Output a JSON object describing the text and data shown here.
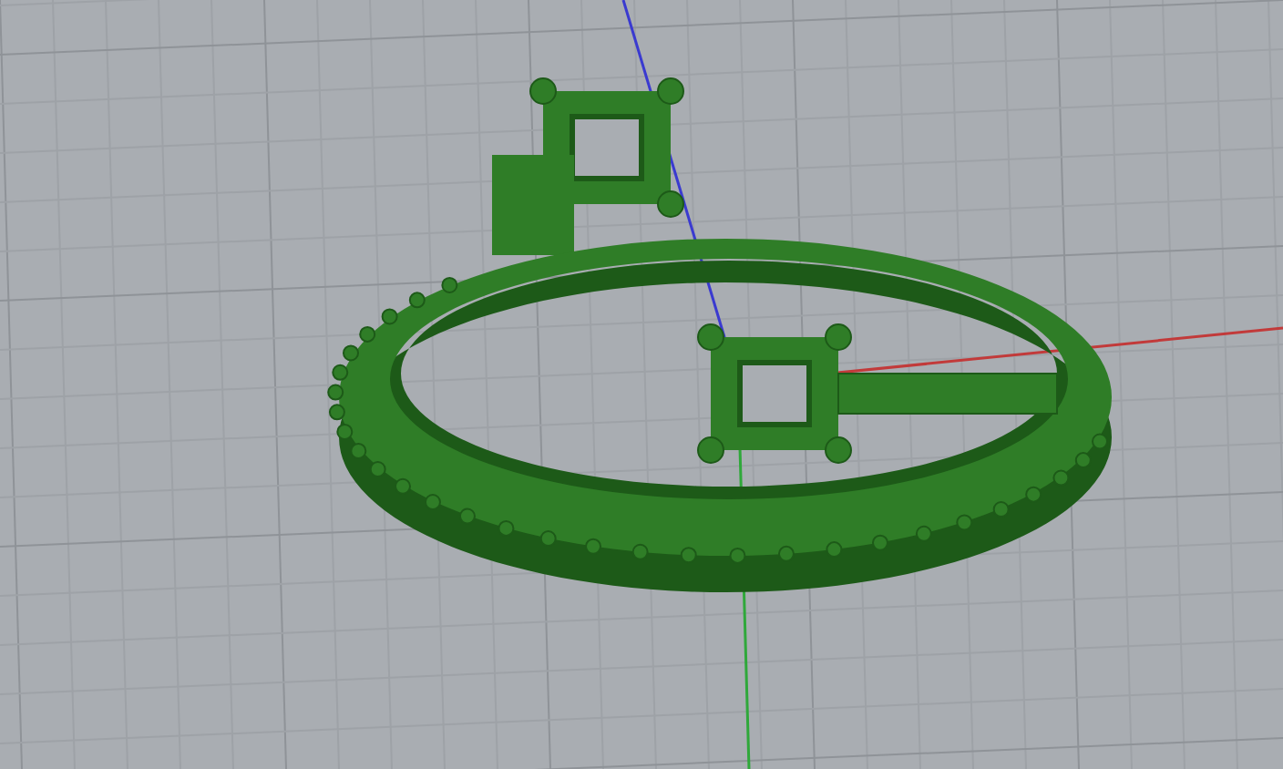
{
  "viewport": {
    "kind": "perspective",
    "grid_visible": true,
    "axes_visible": true
  }
}
